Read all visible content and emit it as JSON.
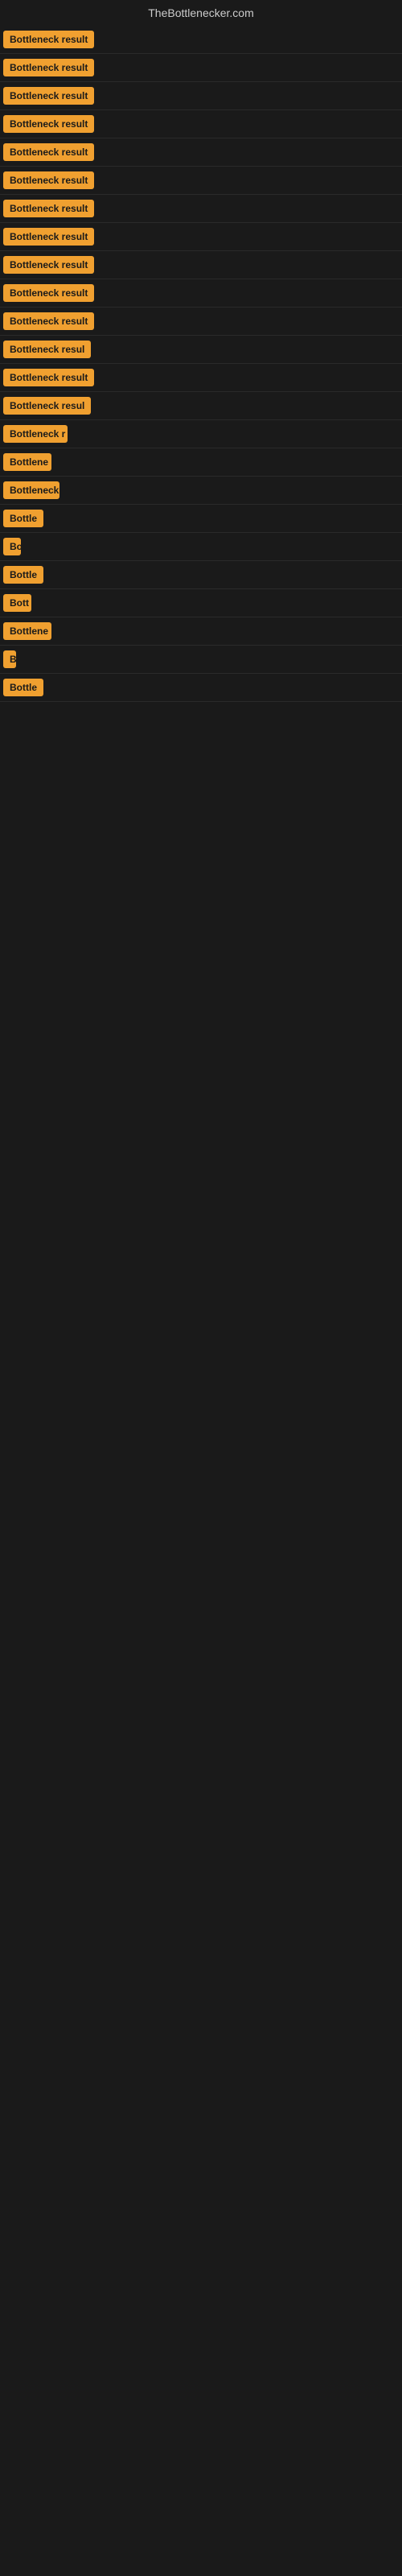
{
  "site": {
    "title": "TheBottlenecker.com"
  },
  "rows": [
    {
      "id": 1,
      "badge": "Bottleneck result",
      "width": 120
    },
    {
      "id": 2,
      "badge": "Bottleneck result",
      "width": 120
    },
    {
      "id": 3,
      "badge": "Bottleneck result",
      "width": 120
    },
    {
      "id": 4,
      "badge": "Bottleneck result",
      "width": 120
    },
    {
      "id": 5,
      "badge": "Bottleneck result",
      "width": 120
    },
    {
      "id": 6,
      "badge": "Bottleneck result",
      "width": 120
    },
    {
      "id": 7,
      "badge": "Bottleneck result",
      "width": 120
    },
    {
      "id": 8,
      "badge": "Bottleneck result",
      "width": 120
    },
    {
      "id": 9,
      "badge": "Bottleneck result",
      "width": 120
    },
    {
      "id": 10,
      "badge": "Bottleneck result",
      "width": 120
    },
    {
      "id": 11,
      "badge": "Bottleneck result",
      "width": 120
    },
    {
      "id": 12,
      "badge": "Bottleneck resul",
      "width": 110
    },
    {
      "id": 13,
      "badge": "Bottleneck result",
      "width": 120
    },
    {
      "id": 14,
      "badge": "Bottleneck resul",
      "width": 110
    },
    {
      "id": 15,
      "badge": "Bottleneck r",
      "width": 80
    },
    {
      "id": 16,
      "badge": "Bottlene",
      "width": 60
    },
    {
      "id": 17,
      "badge": "Bottleneck",
      "width": 70
    },
    {
      "id": 18,
      "badge": "Bottle",
      "width": 50
    },
    {
      "id": 19,
      "badge": "Bo",
      "width": 22
    },
    {
      "id": 20,
      "badge": "Bottle",
      "width": 50
    },
    {
      "id": 21,
      "badge": "Bott",
      "width": 35
    },
    {
      "id": 22,
      "badge": "Bottlene",
      "width": 60
    },
    {
      "id": 23,
      "badge": "B",
      "width": 14
    },
    {
      "id": 24,
      "badge": "Bottle",
      "width": 50
    }
  ]
}
